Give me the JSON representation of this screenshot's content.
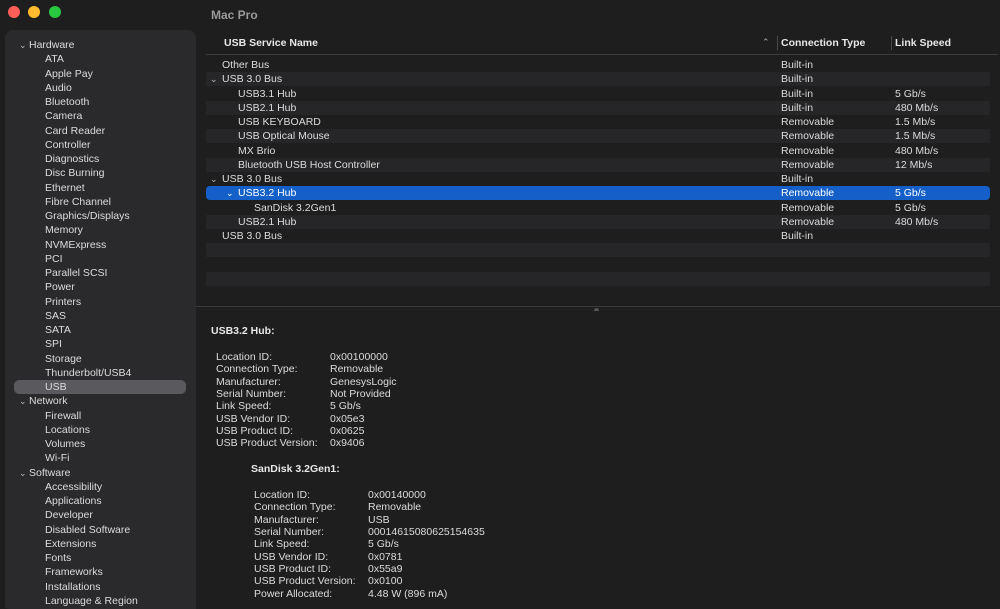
{
  "window": {
    "title": "Mac Pro"
  },
  "sidebar": {
    "categories": [
      {
        "label": "Hardware",
        "items": [
          "ATA",
          "Apple Pay",
          "Audio",
          "Bluetooth",
          "Camera",
          "Card Reader",
          "Controller",
          "Diagnostics",
          "Disc Burning",
          "Ethernet",
          "Fibre Channel",
          "Graphics/Displays",
          "Memory",
          "NVMExpress",
          "PCI",
          "Parallel SCSI",
          "Power",
          "Printers",
          "SAS",
          "SATA",
          "SPI",
          "Storage",
          "Thunderbolt/USB4",
          "USB"
        ]
      },
      {
        "label": "Network",
        "items": [
          "Firewall",
          "Locations",
          "Volumes",
          "Wi-Fi"
        ]
      },
      {
        "label": "Software",
        "items": [
          "Accessibility",
          "Applications",
          "Developer",
          "Disabled Software",
          "Extensions",
          "Fonts",
          "Frameworks",
          "Installations",
          "Language & Region"
        ]
      }
    ],
    "selected": "USB"
  },
  "table": {
    "columns": {
      "name": "USB Service Name",
      "connection": "Connection Type",
      "speed": "Link Speed"
    },
    "rows": [
      {
        "name": "Other Bus",
        "indent": 0,
        "chev": "",
        "connection": "Built-in",
        "speed": ""
      },
      {
        "name": "USB 3.0 Bus",
        "indent": 0,
        "chev": "⌄",
        "connection": "Built-in",
        "speed": ""
      },
      {
        "name": "USB3.1 Hub",
        "indent": 1,
        "chev": "",
        "connection": "Built-in",
        "speed": "5 Gb/s"
      },
      {
        "name": "USB2.1 Hub",
        "indent": 1,
        "chev": "",
        "connection": "Built-in",
        "speed": "480 Mb/s"
      },
      {
        "name": "USB KEYBOARD",
        "indent": 1,
        "chev": "",
        "connection": "Removable",
        "speed": "1.5 Mb/s"
      },
      {
        "name": "USB Optical Mouse",
        "indent": 1,
        "chev": "",
        "connection": "Removable",
        "speed": "1.5 Mb/s"
      },
      {
        "name": "MX Brio",
        "indent": 1,
        "chev": "",
        "connection": "Removable",
        "speed": "480 Mb/s"
      },
      {
        "name": "Bluetooth USB Host Controller",
        "indent": 1,
        "chev": "",
        "connection": "Removable",
        "speed": "12 Mb/s"
      },
      {
        "name": "USB 3.0 Bus",
        "indent": 0,
        "chev": "⌄",
        "connection": "Built-in",
        "speed": ""
      },
      {
        "name": "USB3.2 Hub",
        "indent": 1,
        "chev": "⌄",
        "connection": "Removable",
        "speed": "5 Gb/s",
        "selected": true
      },
      {
        "name": "SanDisk 3.2Gen1",
        "indent": 2,
        "chev": "",
        "connection": "Removable",
        "speed": "5 Gb/s"
      },
      {
        "name": "USB2.1 Hub",
        "indent": 1,
        "chev": "",
        "connection": "Removable",
        "speed": "480 Mb/s"
      },
      {
        "name": "USB 3.0 Bus",
        "indent": 0,
        "chev": "",
        "connection": "Built-in",
        "speed": ""
      }
    ]
  },
  "detail": {
    "title": "USB3.2 Hub:",
    "fields": [
      {
        "k": "Location ID:",
        "v": "0x00100000"
      },
      {
        "k": "Connection Type:",
        "v": "Removable"
      },
      {
        "k": "Manufacturer:",
        "v": "GenesysLogic"
      },
      {
        "k": "Serial Number:",
        "v": "Not Provided"
      },
      {
        "k": "Link Speed:",
        "v": "5 Gb/s"
      },
      {
        "k": "USB Vendor ID:",
        "v": "0x05e3"
      },
      {
        "k": "USB Product ID:",
        "v": "0x0625"
      },
      {
        "k": "USB Product Version:",
        "v": "0x9406"
      }
    ],
    "sub_title": "SanDisk 3.2Gen1:",
    "sub_fields": [
      {
        "k": "Location ID:",
        "v": "0x00140000"
      },
      {
        "k": "Connection Type:",
        "v": "Removable"
      },
      {
        "k": "Manufacturer:",
        "v": " USB"
      },
      {
        "k": "Serial Number:",
        "v": "0001461508062515463​5"
      },
      {
        "k": "Link Speed:",
        "v": "5 Gb/s"
      },
      {
        "k": "USB Vendor ID:",
        "v": "0x0781"
      },
      {
        "k": "USB Product ID:",
        "v": "0x55a9"
      },
      {
        "k": "USB Product Version:",
        "v": "0x0100"
      },
      {
        "k": "Power Allocated:",
        "v": "4.48 W (896 mA)"
      }
    ]
  },
  "colors": {
    "selection": "#1560c8",
    "background": "#1e1e1e",
    "sidebar": "#2a2a2c"
  }
}
